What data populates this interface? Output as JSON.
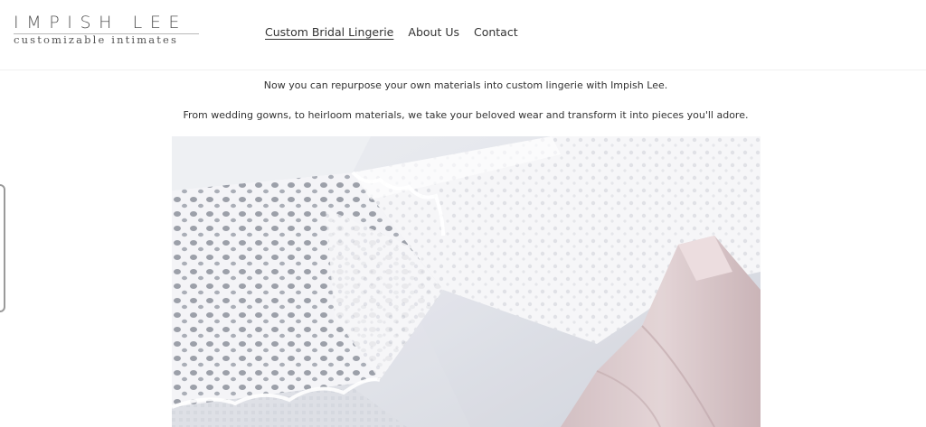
{
  "brand": {
    "title": "IMPISH LEE",
    "tagline": "customizable intimates"
  },
  "nav": {
    "items": [
      {
        "label": "Custom Bridal Lingerie",
        "active": true
      },
      {
        "label": "About Us",
        "active": false
      },
      {
        "label": "Contact",
        "active": false
      }
    ]
  },
  "intro": {
    "line1": "Now you can repurpose your own materials into custom lingerie with Impish Lee.",
    "line2": "From wedding gowns, to heirloom materials, we take your beloved wear and transform it into pieces you'll adore."
  },
  "hero": {
    "icon": "lace-and-ribbon-photo",
    "colors": {
      "lace": "#f6f6f8",
      "shadow": "#b9bcc6",
      "satin": "#e2e4ea",
      "ribbon": "#d8c5c8",
      "ribbon_dark": "#c4acaf"
    }
  }
}
